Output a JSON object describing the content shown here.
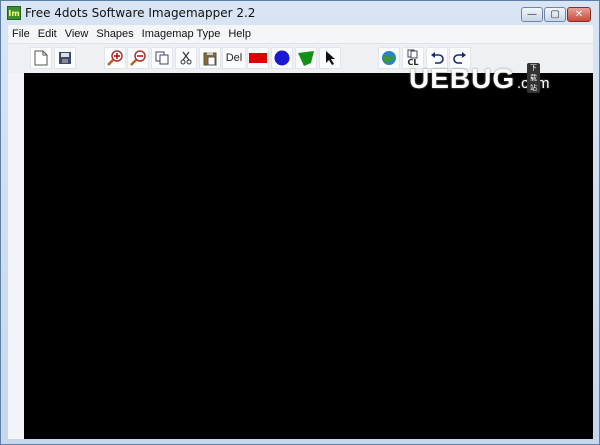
{
  "window": {
    "title": "Free 4dots Software Imagemapper 2.2",
    "app_icon_text": "Im"
  },
  "menu": [
    "File",
    "Edit",
    "View",
    "Shapes",
    "Imagemap Type",
    "Help"
  ],
  "toolbar": {
    "new": "new-document-icon",
    "save": "save-icon",
    "zoom_in": "zoom-in-icon",
    "zoom_out": "zoom-out-icon",
    "copy": "copy-icon",
    "cut": "cut-icon",
    "paste": "paste-icon",
    "del_label": "Del",
    "rect": "rectangle-shape-icon",
    "circle": "circle-shape-icon",
    "polygon": "polygon-shape-icon",
    "pointer": "pointer-icon",
    "web": "web-icon",
    "cl_label": "CL",
    "undo": "undo-icon",
    "redo": "redo-icon"
  },
  "colors": {
    "rect": "#e00000",
    "circle": "#1a1ad6",
    "polygon": "#159016",
    "canvas": "#000000"
  },
  "watermark": {
    "logo": "UEBUG",
    "com": ".com",
    "tag": "下载站"
  }
}
